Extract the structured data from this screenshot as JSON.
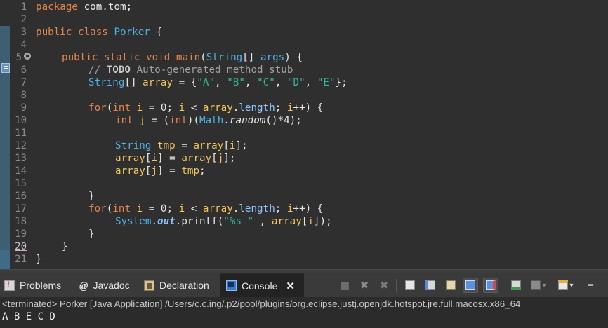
{
  "editor": {
    "line_numbers": [
      "1",
      "2",
      "3",
      "4",
      "5",
      "6",
      "7",
      "8",
      "9",
      "10",
      "11",
      "12",
      "13",
      "14",
      "15",
      "16",
      "17",
      "18",
      "19",
      "20",
      "21"
    ],
    "code": {
      "l1": [
        "package",
        " com.tom;"
      ],
      "l3": [
        "public",
        " ",
        "class",
        " ",
        "Porker",
        " {"
      ],
      "l5": [
        "public",
        " ",
        "static",
        " ",
        "void",
        " ",
        "main",
        "(",
        "String",
        "[] ",
        "args",
        ") {"
      ],
      "l6": [
        "// ",
        "TODO",
        " Auto-generated method stub"
      ],
      "l7": [
        "String",
        "[] ",
        "array",
        " = {",
        "\"A\"",
        ", ",
        "\"B\"",
        ", ",
        "\"C\"",
        ", ",
        "\"D\"",
        ", ",
        "\"E\"",
        "};"
      ],
      "l9": [
        "for",
        "(",
        "int",
        " ",
        "i",
        " = 0; ",
        "i",
        " < ",
        "array",
        ".",
        "length",
        "; ",
        "i",
        "++) {"
      ],
      "l10": [
        "int",
        " ",
        "j",
        " = (",
        "int",
        ")(",
        "Math",
        ".",
        "random",
        "()*4);"
      ],
      "l12": [
        "String",
        " ",
        "tmp",
        " = ",
        "array",
        "[",
        "i",
        "];"
      ],
      "l13": [
        "array",
        "[",
        "i",
        "] = ",
        "array",
        "[",
        "j",
        "];"
      ],
      "l14": [
        "array",
        "[",
        "j",
        "] = ",
        "tmp",
        ";"
      ],
      "l16": [
        "}"
      ],
      "l17": [
        "for",
        "(",
        "int",
        " ",
        "i",
        " = 0; ",
        "i",
        " < ",
        "array",
        ".",
        "length",
        "; ",
        "i",
        "++) {"
      ],
      "l18": [
        "System",
        ".",
        "out",
        ".",
        "printf",
        "(",
        "\"%s \"",
        " , ",
        "array",
        "[",
        "i",
        "]);"
      ],
      "l19": [
        "}"
      ],
      "l20": [
        "}"
      ],
      "l21": [
        "}"
      ]
    }
  },
  "panel": {
    "tabs": {
      "problems": "Problems",
      "javadoc": "Javadoc",
      "declaration": "Declaration",
      "console": "Console"
    },
    "javadoc_glyph": "@",
    "close_glyph": "✕",
    "toolbar": {
      "terminate": "■",
      "remove": "✖",
      "remove_all": "✖",
      "minimize": "━",
      "dropdown": "▾"
    },
    "console_header": "<terminated> Porker [Java Application] /Users/c.c.ing/.p2/pool/plugins/org.eclipse.justj.openjdk.hotspot.jre.full.macosx.x86_64",
    "console_output": "A B E C D"
  },
  "colors": {
    "keyword": "#e3854e",
    "type": "#4fb0e3",
    "variable": "#f2c55c",
    "string": "#2fb69b",
    "comment": "#a0a0a0",
    "field": "#8fc5ff"
  }
}
